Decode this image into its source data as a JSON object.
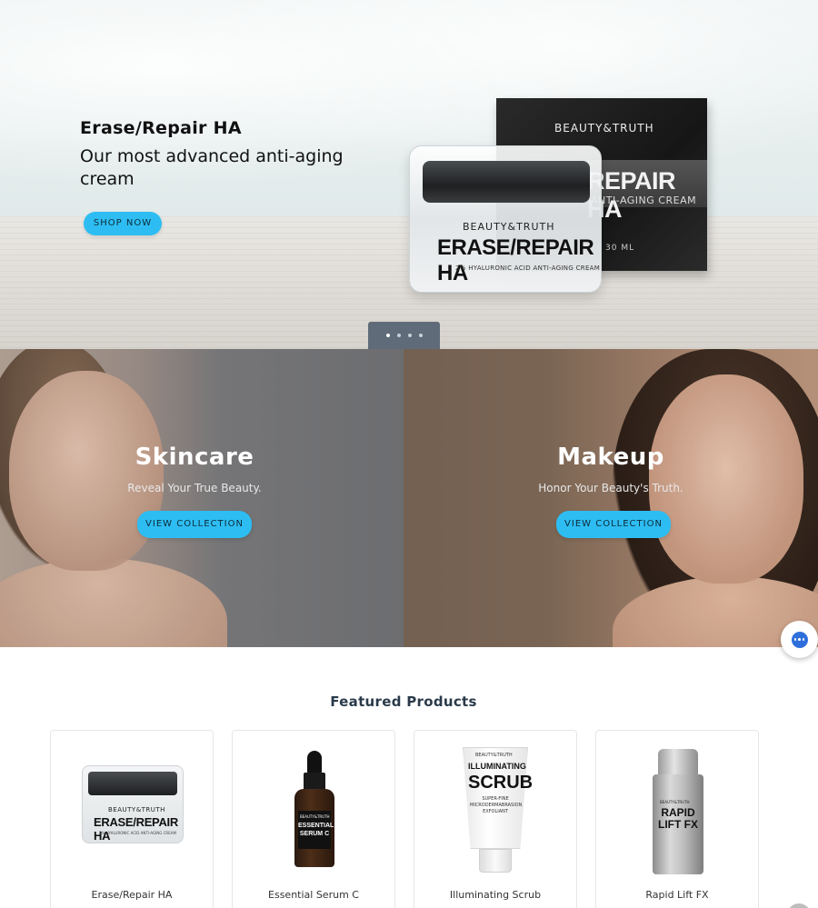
{
  "hero": {
    "title": "Erase/Repair HA",
    "subtitle": "Our most advanced anti-aging cream",
    "cta_label": "SHOP NOW",
    "product_box": {
      "brand": "BEAUTY&TRUTH",
      "name": "REPAIR HA",
      "tagline": "ANTI-AGING CREAM",
      "volume": "30 ML"
    },
    "product_jar": {
      "brand": "BEAUTY&TRUTH",
      "name": "ERASE/REPAIR HA",
      "tagline": "2% HYALURONIC ACID ANTI-AGING CREAM"
    },
    "slider": {
      "count": 4,
      "active_index": 0
    }
  },
  "collections": [
    {
      "title": "Skincare",
      "subtitle": "Reveal Your True Beauty.",
      "cta_label": "VIEW COLLECTION"
    },
    {
      "title": "Makeup",
      "subtitle": "Honor Your Beauty's Truth.",
      "cta_label": "VIEW COLLECTION"
    }
  ],
  "featured": {
    "title": "Featured Products",
    "products": [
      {
        "name": "Erase/Repair HA",
        "label_brand": "BEAUTY&TRUTH",
        "label_name": "ERASE/REPAIR HA",
        "label_tagline": "2% HYALURONIC ACID ANTI-AGING CREAM"
      },
      {
        "name": "Essential Serum C",
        "label_brand": "BEAUTY&TRUTH",
        "label_name": "ESSENTIAL SERUM C"
      },
      {
        "name": "Illuminating Scrub",
        "label_brand": "BEAUTY&TRUTH",
        "label_top": "ILLUMINATING",
        "label_name": "SCRUB",
        "label_tagline": "SUPER-FINE MICRODERMABRASION EXFOLIANT"
      },
      {
        "name": "Rapid Lift FX",
        "label_brand": "BEAUTY&TRUTH",
        "label_name": "RAPID LIFT FX"
      }
    ]
  },
  "colors": {
    "accent": "#2dbdf2",
    "slider_tab": "#5f6b78",
    "chat": "#2f6fdc"
  },
  "icons": {
    "chat": "chat-bubble-icon"
  }
}
